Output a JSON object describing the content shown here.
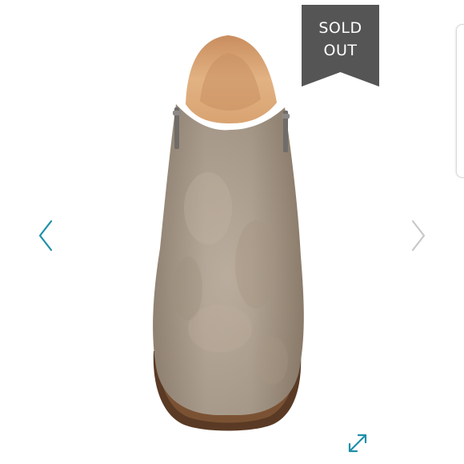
{
  "badge": {
    "line1": "SOLD",
    "line2": "OUT",
    "color": "#555555"
  },
  "icons": {
    "prev": "chevron-left-icon",
    "next": "chevron-right-icon",
    "expand": "expand-diagonal-icon"
  },
  "colors": {
    "accent": "#1f8fa8",
    "next_arrow": "#c8c8c8",
    "suede": "#b0a08e",
    "lining": "#dca878",
    "sole": "#5a3a24"
  }
}
